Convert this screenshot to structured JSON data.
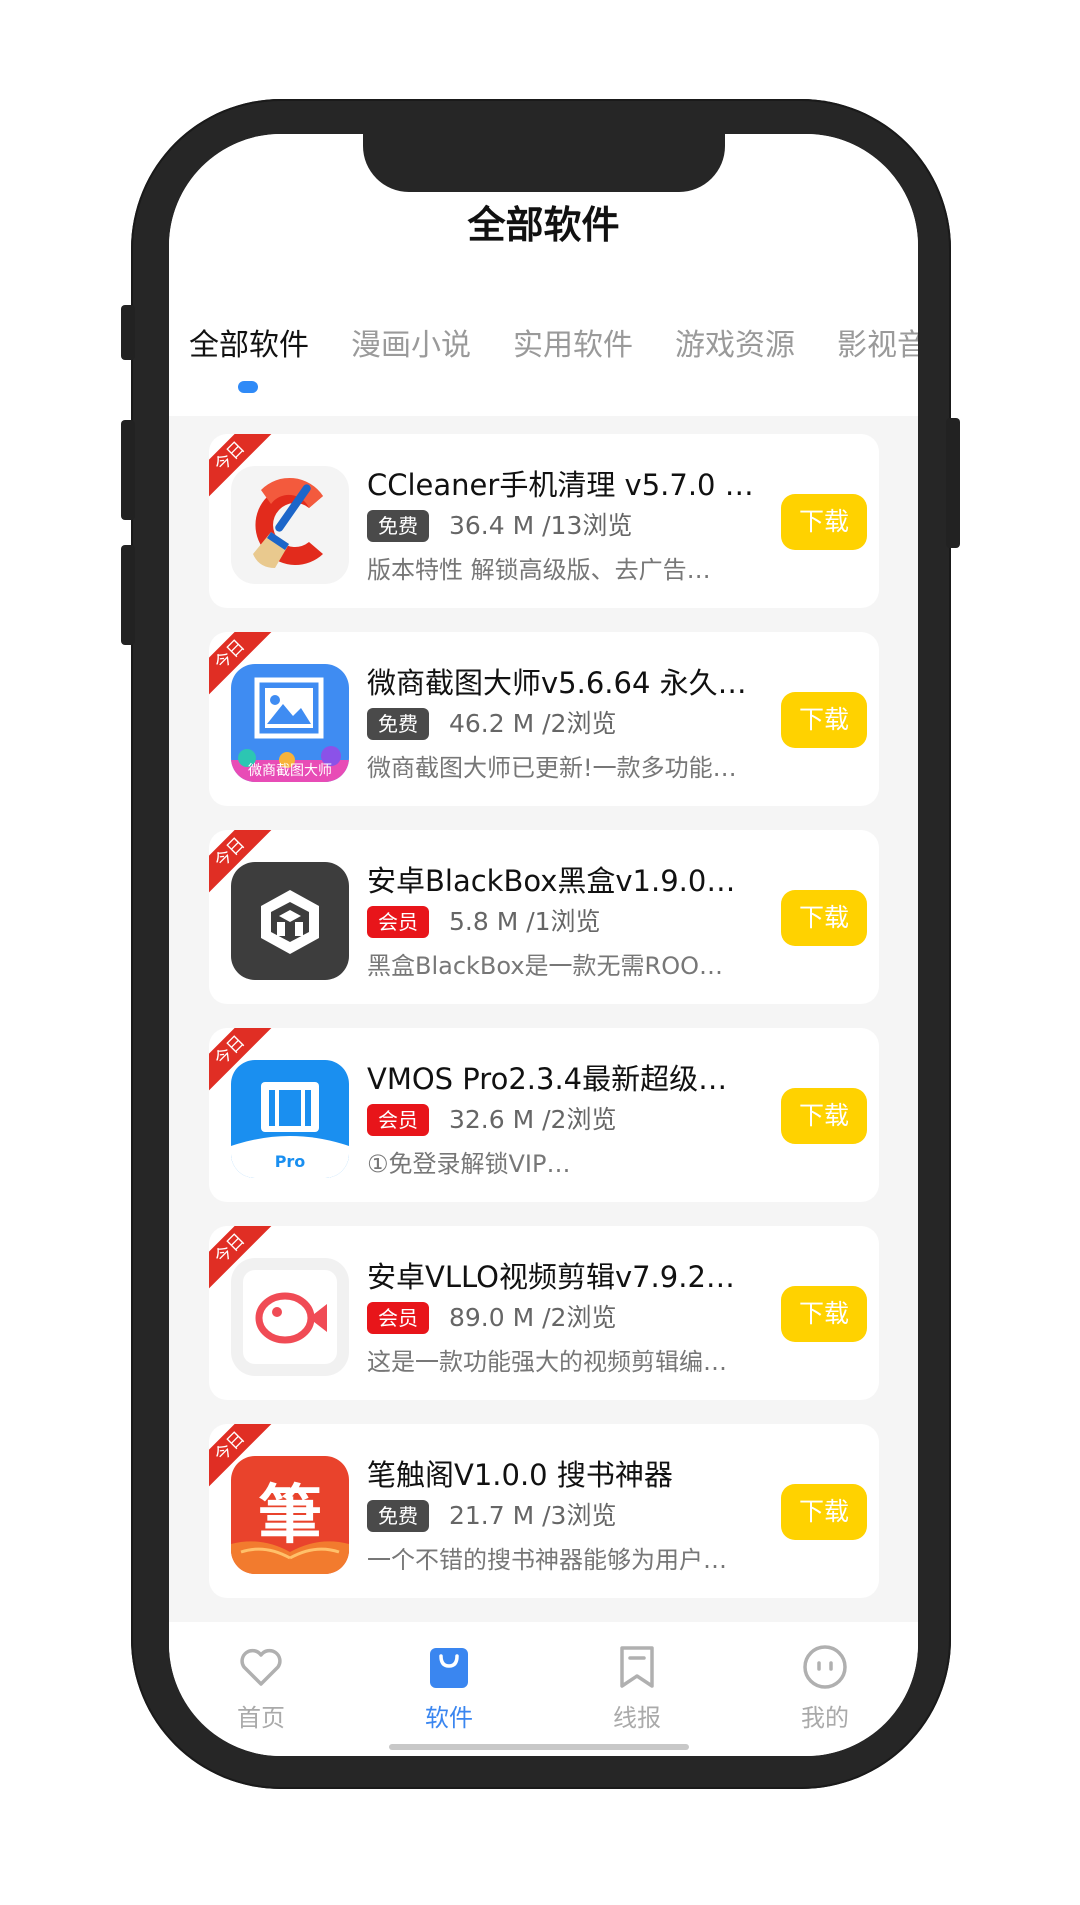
{
  "header": {
    "title": "全部软件"
  },
  "tabs": [
    {
      "label": "全部软件",
      "active": true
    },
    {
      "label": "漫画小说",
      "active": false
    },
    {
      "label": "实用软件",
      "active": false
    },
    {
      "label": "游戏资源",
      "active": false
    },
    {
      "label": "影视音",
      "active": false
    }
  ],
  "colors": {
    "accent": "#2f8af7",
    "download": "#ffd200",
    "vip": "#e8151a",
    "free": "#4a4a4a",
    "ribbon": "#e02e24"
  },
  "apps": [
    {
      "ribbon": "今日",
      "icon": "ccleaner-icon",
      "title": "CCleaner手机清理 v5.7.0 …",
      "badge": "免费",
      "meta": "36.4 M /13浏览",
      "desc": "版本特性 解锁高级版、去广告…",
      "button": "下载"
    },
    {
      "ribbon": "今日",
      "icon": "screenshot-master-icon",
      "title": "微商截图大师v5.6.64 永久…",
      "badge": "免费",
      "meta": "46.2 M /2浏览",
      "desc": "微商截图大师已更新!一款多功能…",
      "icon_text": "微商截图大师",
      "button": "下载"
    },
    {
      "ribbon": "今日",
      "icon": "blackbox-icon",
      "title": "安卓BlackBox黑盒v1.9.0…",
      "badge": "会员",
      "meta": "5.8 M /1浏览",
      "desc": "黑盒BlackBox是一款无需ROO…",
      "button": "下载"
    },
    {
      "ribbon": "今日",
      "icon": "vmos-icon",
      "title": "VMOS Pro2.3.4最新超级…",
      "badge": "会员",
      "meta": "32.6 M /2浏览",
      "desc": "①免登录解锁VIP…",
      "icon_text": "Pro",
      "button": "下载"
    },
    {
      "ribbon": "今日",
      "icon": "vllo-icon",
      "title": "安卓VLLO视频剪辑v7.9.2…",
      "badge": "会员",
      "meta": "89.0 M /2浏览",
      "desc": "这是一款功能强大的视频剪辑编…",
      "button": "下载"
    },
    {
      "ribbon": "今日",
      "icon": "bichuge-icon",
      "title": "笔触阁V1.0.0 搜书神器",
      "badge": "免费",
      "meta": "21.7 M /3浏览",
      "desc": "一个不错的搜书神器能够为用户…",
      "icon_text": "筆",
      "button": "下载"
    }
  ],
  "nav": [
    {
      "label": "首页",
      "icon": "heart-icon",
      "active": false
    },
    {
      "label": "软件",
      "icon": "shopping-bag-icon",
      "active": true
    },
    {
      "label": "线报",
      "icon": "bookmark-icon",
      "active": false
    },
    {
      "label": "我的",
      "icon": "smiley-face-icon",
      "active": false
    }
  ]
}
